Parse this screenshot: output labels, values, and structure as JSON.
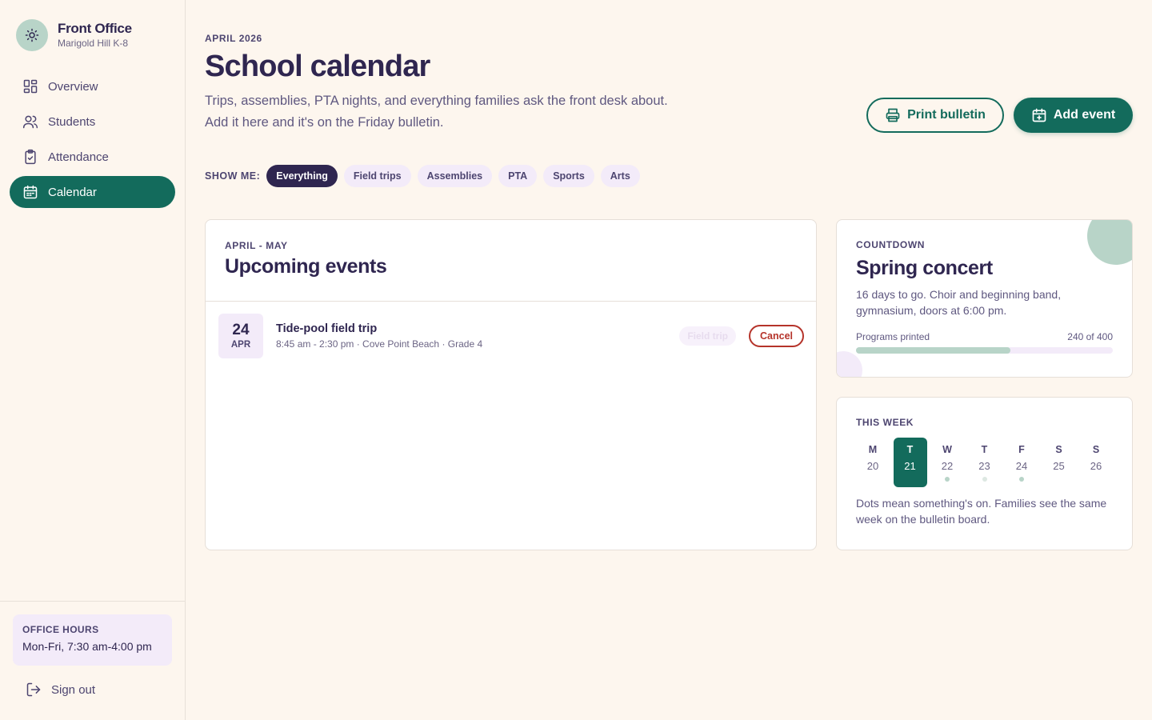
{
  "brand": {
    "title": "Front Office",
    "subtitle": "Marigold Hill K-8"
  },
  "nav": [
    {
      "label": "Overview",
      "icon": "grid-icon"
    },
    {
      "label": "Students",
      "icon": "users-icon"
    },
    {
      "label": "Attendance",
      "icon": "clipboard-check-icon"
    },
    {
      "label": "Calendar",
      "icon": "calendar-icon",
      "active": true
    }
  ],
  "office_hours": {
    "label": "OFFICE HOURS",
    "value": "Mon-Fri, 7:30 am-4:00 pm"
  },
  "signout": {
    "label": "Sign out"
  },
  "header": {
    "eyebrow": "APRIL 2026",
    "title": "School calendar",
    "description": "Trips, assemblies, PTA nights, and everything families ask the front desk about. Add it here and it's on the Friday bulletin.",
    "print_label": "Print bulletin",
    "add_label": "Add event"
  },
  "filters": {
    "label": "SHOW ME:",
    "options": [
      "Everything",
      "Field trips",
      "Assemblies",
      "PTA",
      "Sports",
      "Arts"
    ],
    "selected": "Everything"
  },
  "events": {
    "eyebrow": "APRIL - MAY",
    "title": "Upcoming events",
    "items": [
      {
        "day": "24",
        "month": "APR",
        "name": "Tide-pool field trip",
        "meta": "8:45 am - 2:30 pm · Cove Point Beach · Grade 4",
        "tag": "Field trip",
        "action": "Cancel"
      }
    ]
  },
  "countdown": {
    "eyebrow": "COUNTDOWN",
    "title": "Spring concert",
    "description": "16 days to go. Choir and beginning band, gymnasium, doors at 6:00 pm.",
    "progress_label": "Programs printed",
    "progress_text": "240 of 400",
    "progress_value": 240,
    "progress_total": 400
  },
  "week": {
    "eyebrow": "THIS WEEK",
    "days": [
      {
        "letter": "M",
        "num": "20",
        "dot": "none"
      },
      {
        "letter": "T",
        "num": "21",
        "dot": "none",
        "active": true
      },
      {
        "letter": "W",
        "num": "22",
        "dot": "green"
      },
      {
        "letter": "T",
        "num": "23",
        "dot": "light"
      },
      {
        "letter": "F",
        "num": "24",
        "dot": "green"
      },
      {
        "letter": "S",
        "num": "25",
        "dot": "none"
      },
      {
        "letter": "S",
        "num": "26",
        "dot": "none"
      }
    ],
    "note": "Dots mean something's on. Families see the same week on the bulletin board."
  },
  "colors": {
    "accent": "#136b5c",
    "ink": "#2f2650",
    "mint": "#b8d4c8",
    "lavender": "#f3ebf9",
    "danger": "#b5332a",
    "background": "#fdf6ee"
  }
}
